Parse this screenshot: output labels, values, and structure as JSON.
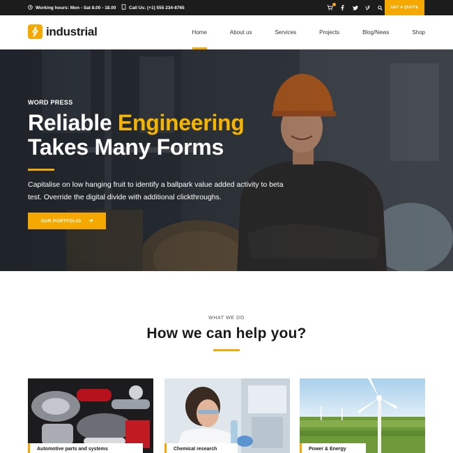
{
  "topbar": {
    "hours": "Working hours:  Mon - Sat 8.00 - 18.00",
    "phone": "Call Us:  (+1) 555 234-8765",
    "quote_label": "GET A QUOTE"
  },
  "brand": {
    "name": "industrial",
    "accent": "#f5a800"
  },
  "nav": {
    "items": [
      {
        "label": "Home"
      },
      {
        "label": "About us"
      },
      {
        "label": "Services"
      },
      {
        "label": "Projects"
      },
      {
        "label": "Blog/News"
      },
      {
        "label": "Shop"
      }
    ]
  },
  "hero": {
    "eyebrow": "WORD PRESS",
    "title_line1_a": "Reliable ",
    "title_line1_b": "Engineering",
    "title_line2": "Takes Many Forms",
    "text": "Capitalise on low hanging fruit to identify a ballpark value added activity to beta test. Override the digital divide with additional clickthroughs.",
    "button_label": "OUR PORTFOLIO"
  },
  "services": {
    "eyebrow": "WHAT WE DO",
    "title": "How we can help you?",
    "cards": [
      {
        "label": "Automotive parts and systems"
      },
      {
        "label": "Chemical research"
      },
      {
        "label": "Power & Energy"
      }
    ]
  }
}
